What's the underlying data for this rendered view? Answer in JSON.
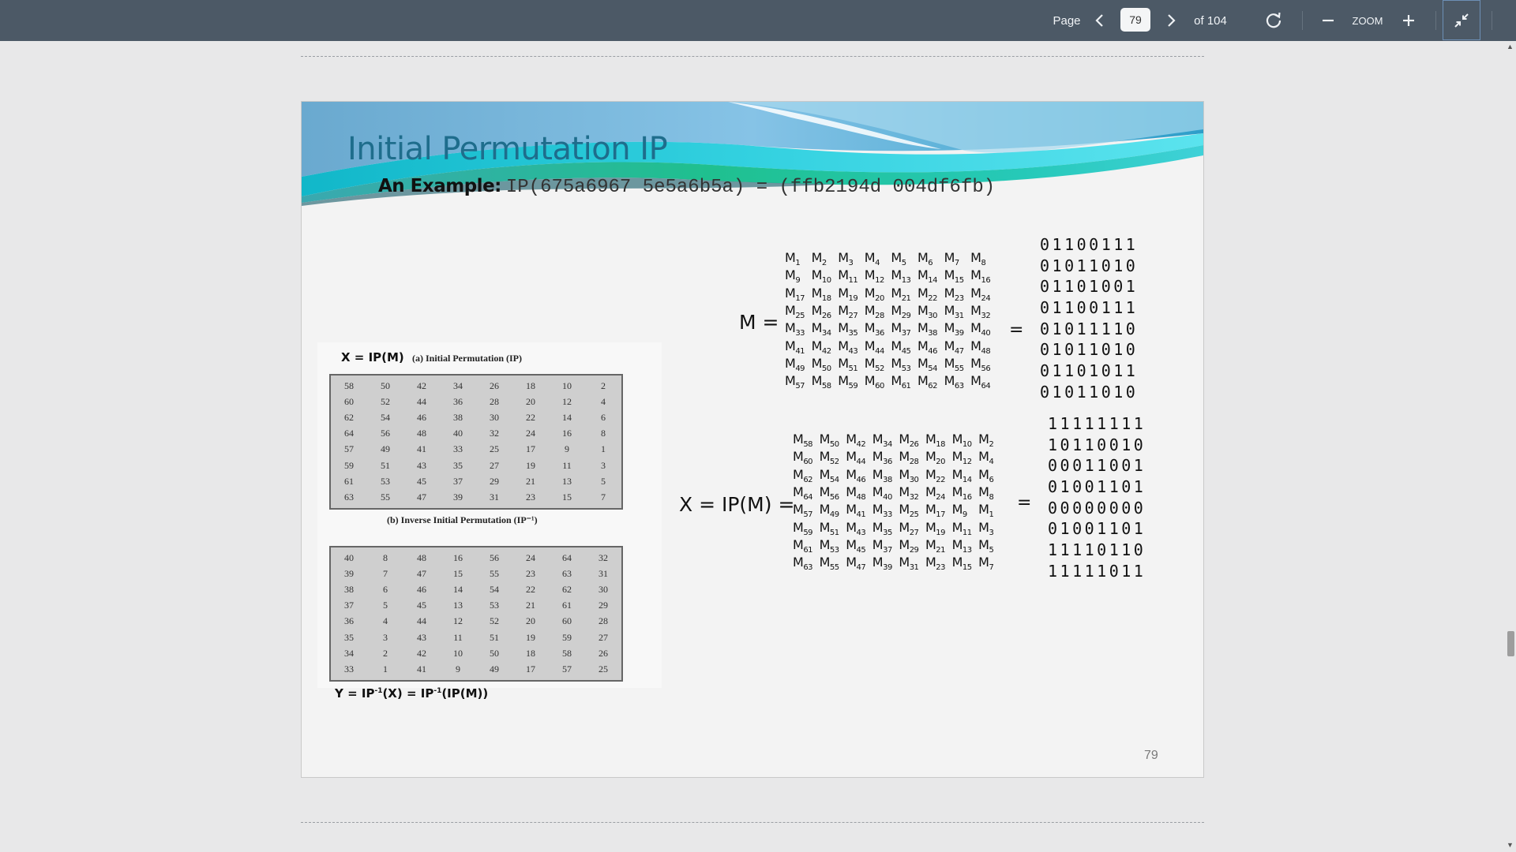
{
  "toolbar": {
    "page_label": "Page",
    "current_page": "79",
    "of_label": "of 104",
    "zoom_label": "ZOOM"
  },
  "slide": {
    "title": "Initial Permutation IP",
    "example_label": "An Example:",
    "example_code": "IP(675a6967 5e5a6b5a) = (ffb2194d 004df6fb)",
    "page_number": "79",
    "tables": {
      "x_formula": "X = IP(M)",
      "ip_caption": "(a) Initial Permutation (IP)",
      "ip_rows": [
        [
          "58",
          "50",
          "42",
          "34",
          "26",
          "18",
          "10",
          "2"
        ],
        [
          "60",
          "52",
          "44",
          "36",
          "28",
          "20",
          "12",
          "4"
        ],
        [
          "62",
          "54",
          "46",
          "38",
          "30",
          "22",
          "14",
          "6"
        ],
        [
          "64",
          "56",
          "48",
          "40",
          "32",
          "24",
          "16",
          "8"
        ],
        [
          "57",
          "49",
          "41",
          "33",
          "25",
          "17",
          "9",
          "1"
        ],
        [
          "59",
          "51",
          "43",
          "35",
          "27",
          "19",
          "11",
          "3"
        ],
        [
          "61",
          "53",
          "45",
          "37",
          "29",
          "21",
          "13",
          "5"
        ],
        [
          "63",
          "55",
          "47",
          "39",
          "31",
          "23",
          "15",
          "7"
        ]
      ],
      "inv_caption": "(b) Inverse Initial Permutation (IP⁻¹)",
      "inv_rows": [
        [
          "40",
          "8",
          "48",
          "16",
          "56",
          "24",
          "64",
          "32"
        ],
        [
          "39",
          "7",
          "47",
          "15",
          "55",
          "23",
          "63",
          "31"
        ],
        [
          "38",
          "6",
          "46",
          "14",
          "54",
          "22",
          "62",
          "30"
        ],
        [
          "37",
          "5",
          "45",
          "13",
          "53",
          "21",
          "61",
          "29"
        ],
        [
          "36",
          "4",
          "44",
          "12",
          "52",
          "20",
          "60",
          "28"
        ],
        [
          "35",
          "3",
          "43",
          "11",
          "51",
          "19",
          "59",
          "27"
        ],
        [
          "34",
          "2",
          "42",
          "10",
          "50",
          "18",
          "58",
          "26"
        ],
        [
          "33",
          "1",
          "41",
          "9",
          "49",
          "17",
          "57",
          "25"
        ]
      ],
      "y_formula_prefix": "Y = IP",
      "y_formula_mid": "(X) = IP",
      "y_formula_end": "(IP(M))",
      "inverse_exponent": "-1"
    },
    "m_label": "M =",
    "m_indices": [
      [
        1,
        2,
        3,
        4,
        5,
        6,
        7,
        8
      ],
      [
        9,
        10,
        11,
        12,
        13,
        14,
        15,
        16
      ],
      [
        17,
        18,
        19,
        20,
        21,
        22,
        23,
        24
      ],
      [
        25,
        26,
        27,
        28,
        29,
        30,
        31,
        32
      ],
      [
        33,
        34,
        35,
        36,
        37,
        38,
        39,
        40
      ],
      [
        41,
        42,
        43,
        44,
        45,
        46,
        47,
        48
      ],
      [
        49,
        50,
        51,
        52,
        53,
        54,
        55,
        56
      ],
      [
        57,
        58,
        59,
        60,
        61,
        62,
        63,
        64
      ]
    ],
    "m_equals": "=",
    "m_bits": [
      "01100111",
      "01011010",
      "01101001",
      "01100111",
      "01011110",
      "01011010",
      "01101011",
      "01011010"
    ],
    "x_label": "X = IP(M) =",
    "x_indices": [
      [
        58,
        50,
        42,
        34,
        26,
        18,
        10,
        2
      ],
      [
        60,
        52,
        44,
        36,
        28,
        20,
        12,
        4
      ],
      [
        62,
        54,
        46,
        38,
        30,
        22,
        14,
        6
      ],
      [
        64,
        56,
        48,
        40,
        32,
        24,
        16,
        8
      ],
      [
        57,
        49,
        41,
        33,
        25,
        17,
        9,
        1
      ],
      [
        59,
        51,
        43,
        35,
        27,
        19,
        11,
        3
      ],
      [
        61,
        53,
        45,
        37,
        29,
        21,
        13,
        5
      ],
      [
        63,
        55,
        47,
        39,
        31,
        23,
        15,
        7
      ]
    ],
    "x_equals": "=",
    "x_bits": [
      "11111111",
      "10110010",
      "00011001",
      "01001101",
      "00000000",
      "01001101",
      "11110110",
      "11111011"
    ],
    "symbol_letter": "M"
  },
  "icons": [
    "chevron-left-icon",
    "chevron-right-icon",
    "rotate-icon",
    "zoom-out-icon",
    "zoom-in-icon",
    "exit-fullscreen-icon"
  ],
  "colors": {
    "toolbar": "#4c5966",
    "title": "#1e6d8c",
    "background": "#e8e8e9"
  }
}
